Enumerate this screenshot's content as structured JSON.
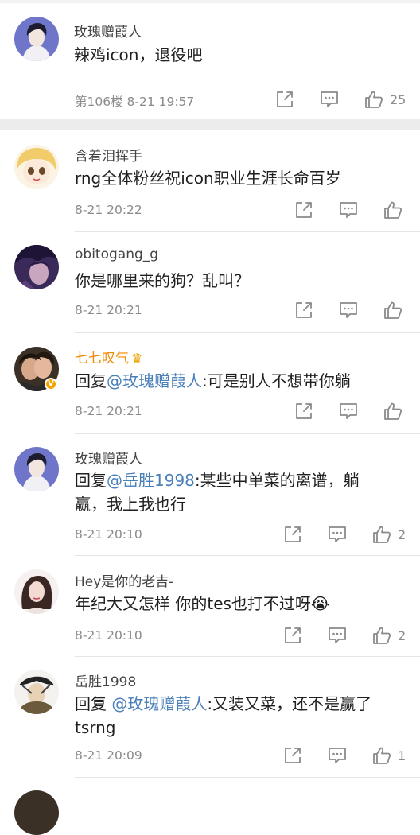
{
  "main_comment": {
    "username": "玫瑰赠葭人",
    "text": "辣鸡icon，退役吧",
    "meta": "第106楼 8-21 19:57",
    "likes": "25"
  },
  "replies": [
    {
      "username": "含着泪挥手",
      "prefix": "",
      "mention": "",
      "text": "rng全体粉丝祝icon职业生涯长命百岁",
      "time": "8-21 20:22",
      "likes": ""
    },
    {
      "username": "obitogang_g",
      "prefix": "",
      "mention": "",
      "text": "你是哪里来的狗？乱叫？",
      "time": "8-21 20:21",
      "likes": ""
    },
    {
      "username": "七七叹气",
      "prefix": "回复",
      "mention": "@玫瑰赠葭人",
      "text": ":可是别人不想带你躺",
      "time": "8-21 20:21",
      "likes": ""
    },
    {
      "username": "玫瑰赠葭人",
      "prefix": "回复",
      "mention": "@岳胜1998",
      "text": ":某些中单菜的离谱，躺",
      "text2": "赢，我上我也行",
      "time": "8-21 20:10",
      "likes": "2"
    },
    {
      "username": "Hey是你的老吉-",
      "prefix": "",
      "mention": "",
      "text": "年纪大又怎样 你的tes也打不过呀😭",
      "time": "8-21 20:10",
      "likes": "2"
    },
    {
      "username": "岳胜1998",
      "prefix": "回复 ",
      "mention": "@玫瑰赠葭人",
      "text": ":又装又菜，还不是赢了",
      "text2": "tsrng",
      "time": "8-21 20:09",
      "likes": "1"
    }
  ],
  "icons": {
    "repost": "repost-icon",
    "comment": "comment-icon",
    "like": "thumbs-up-icon",
    "crown": "crown-badge-icon",
    "verified": "verified-badge-icon"
  },
  "colors": {
    "mention": "#4a7fb8",
    "vip_name": "#f08a00",
    "meta_gray": "#8a8a8a"
  }
}
